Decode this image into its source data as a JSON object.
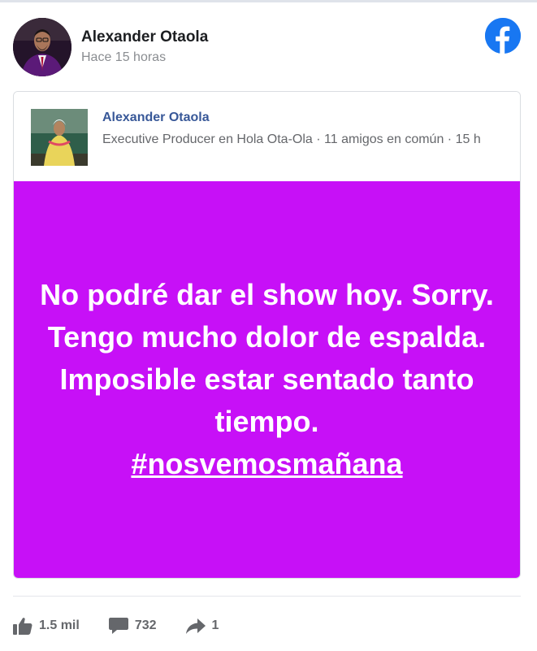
{
  "post": {
    "author_name": "Alexander Otaola",
    "timestamp": "Hace 15 horas",
    "source_icon": "facebook-logo-icon"
  },
  "shared": {
    "name": "Alexander Otaola",
    "meta": "Executive Producer en Hola Ota-Ola · 11 amigos en común · 15 h"
  },
  "status": {
    "text": "No podré dar el show hoy. Sorry. Tengo mucho dolor de espalda. Imposible estar sentado tanto tiempo.",
    "hashtag": "#nosvemosmañana",
    "background_color": "#c710f7"
  },
  "stats": {
    "likes": "1.5 mil",
    "comments": "732",
    "shares": "1",
    "icons": [
      "like-icon",
      "comment-icon",
      "share-icon"
    ]
  },
  "colors": {
    "facebook_blue": "#1877f2",
    "link_blue": "#385898",
    "muted_gray": "#65676b"
  }
}
